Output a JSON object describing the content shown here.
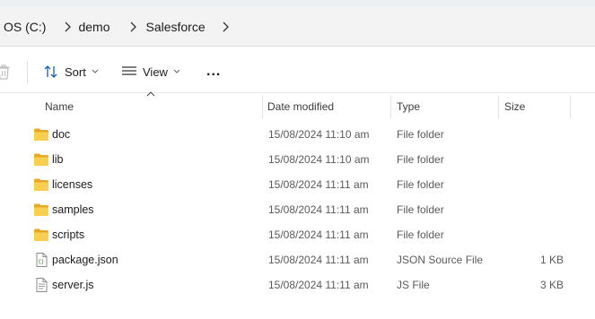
{
  "breadcrumb": {
    "items": [
      "OS (C:)",
      "demo",
      "Salesforce"
    ]
  },
  "toolbar": {
    "sort_label": "Sort",
    "view_label": "View",
    "more_label": "..."
  },
  "columns": {
    "name": "Name",
    "date": "Date modified",
    "type": "Type",
    "size": "Size"
  },
  "files": [
    {
      "name": "doc",
      "date": "15/08/2024 11:10 am",
      "type": "File folder",
      "size": "",
      "icon": "folder-icon"
    },
    {
      "name": "lib",
      "date": "15/08/2024 11:10 am",
      "type": "File folder",
      "size": "",
      "icon": "folder-icon"
    },
    {
      "name": "licenses",
      "date": "15/08/2024 11:11 am",
      "type": "File folder",
      "size": "",
      "icon": "folder-icon"
    },
    {
      "name": "samples",
      "date": "15/08/2024 11:11 am",
      "type": "File folder",
      "size": "",
      "icon": "folder-icon"
    },
    {
      "name": "scripts",
      "date": "15/08/2024 11:11 am",
      "type": "File folder",
      "size": "",
      "icon": "folder-icon"
    },
    {
      "name": "package.json",
      "date": "15/08/2024 11:11 am",
      "type": "JSON Source File",
      "size": "1 KB",
      "icon": "json-file-icon"
    },
    {
      "name": "server.js",
      "date": "15/08/2024 11:11 am",
      "type": "JS File",
      "size": "3 KB",
      "icon": "text-file-icon"
    }
  ],
  "colors": {
    "folder": "#f4c542",
    "accent": "#0067c0",
    "address_bg": "#f3f3f3"
  }
}
